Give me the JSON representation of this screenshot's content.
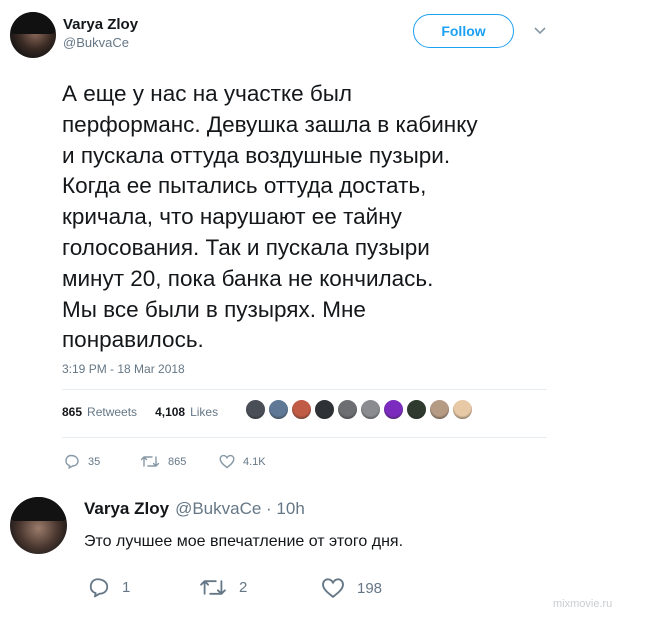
{
  "tweet": {
    "author_name": "Varya Zloy",
    "author_handle": "@BukvaCe",
    "follow_label": "Follow",
    "text": "А еще у нас на участке был\nперформанс. Девушка зашла в кабинку\nи пускала оттуда воздушные пузыри.\nКогда ее пытались оттуда достать,\nкричала, что нарушают ее тайну\nголосования. Так и пускала пузыри\nминут 20, пока банка не кончилась.\nМы все были в пузырях. Мне\nпонравилось.",
    "timestamp": "3:19 PM - 18 Mar 2018",
    "retweets_count": "865",
    "retweets_label": "Retweets",
    "likes_count": "4,108",
    "likes_label": "Likes",
    "liker_avatar_colors": [
      "#4a4f57",
      "#5f7896",
      "#c05b46",
      "#2e3136",
      "#6d6e71",
      "#8a8c8f",
      "#7b2cbf",
      "#2f3b2f",
      "#b59a84",
      "#e8c9a6"
    ],
    "actions": {
      "reply_count": "35",
      "retweet_count": "865",
      "like_count": "4.1K"
    }
  },
  "reply": {
    "author_name": "Varya Zloy",
    "meta": "@BukvaCe · 10h",
    "text": "Это лучшее мое впечатление от этого дня.",
    "actions": {
      "reply_count": "1",
      "retweet_count": "2",
      "like_count": "198"
    }
  },
  "watermark": "mixmovie.ru",
  "colors": {
    "accent": "#1da1f2",
    "secondary_text": "#657786",
    "separator": "#e6ecf0"
  }
}
